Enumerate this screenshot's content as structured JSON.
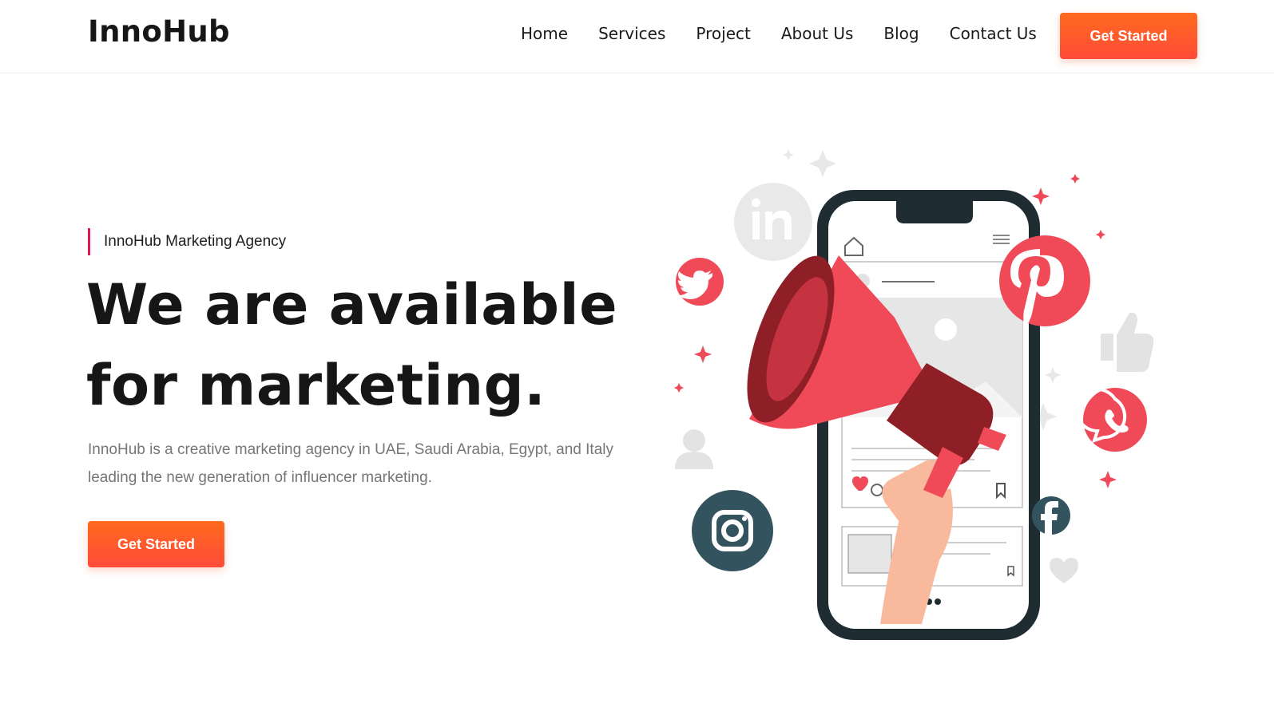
{
  "brand": {
    "name": "InnoHub"
  },
  "nav": {
    "items": [
      "Home",
      "Services",
      "Project",
      "About Us",
      "Blog",
      "Contact Us"
    ],
    "cta_label": "Get Started"
  },
  "hero": {
    "eyebrow": "InnoHub Marketing Agency",
    "headline_line1": "We are available",
    "headline_line2": "for marketing.",
    "description": "InnoHub is a creative marketing agency in UAE, Saudi Arabia, Egypt, and Italy leading the new generation of influencer marketing.",
    "cta_label": "Get Started"
  },
  "illustration": {
    "icons": [
      "linkedin-icon",
      "twitter-icon",
      "pinterest-icon",
      "thumbs-up-icon",
      "whatsapp-icon",
      "user-icon",
      "instagram-icon",
      "facebook-icon",
      "heart-icon",
      "home-icon",
      "menu-icon",
      "bookmark-icon",
      "megaphone-icon"
    ]
  },
  "colors": {
    "accent_orange": "#ff5a2a",
    "accent_red": "#fa4a5a",
    "eyebrow_bar": "#e3164f",
    "phone_frame": "#1f2d33",
    "text_dark": "#161616",
    "text_muted": "#767676"
  }
}
